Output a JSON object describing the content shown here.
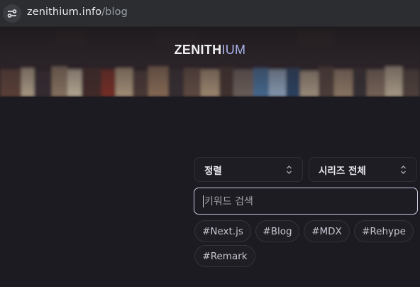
{
  "browser": {
    "url_host": "zenithium.info",
    "url_path": "/blog"
  },
  "hero": {
    "title_part1": "ZENITH",
    "title_part2": "IUM"
  },
  "filters": {
    "sort_label": "정렬",
    "series_label": "시리즈 전체"
  },
  "search": {
    "placeholder": "키워드 검색"
  },
  "tags": [
    "#Next.js",
    "#Blog",
    "#MDX",
    "#Rehype",
    "#Remark"
  ],
  "colors": {
    "background": "#1c1b21",
    "accent": "#a9b3e8",
    "search_border": "#c9c8de"
  }
}
